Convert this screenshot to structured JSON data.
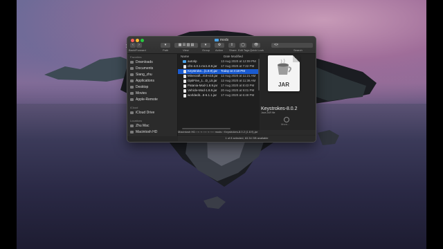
{
  "window": {
    "title": "mods"
  },
  "toolbar": {
    "back_forward_label": "Back/Forward",
    "path_label": "Path",
    "view_label": "View",
    "group_label": "Group",
    "action_label": "Action",
    "share_label": "Share",
    "edit_tags_label": "Edit Tags",
    "quick_look_label": "Quick Look",
    "search_label": "Search"
  },
  "sidebar": {
    "favorites_header": "Favorites",
    "icloud_header": "iCloud",
    "locations_header": "Locations",
    "favorites": [
      {
        "label": "Downloads",
        "icon": "downloads-icon"
      },
      {
        "label": "Documents",
        "icon": "documents-icon"
      },
      {
        "label": "Siang_zhu",
        "icon": "home-icon"
      },
      {
        "label": "Applications",
        "icon": "applications-icon"
      },
      {
        "label": "Desktop",
        "icon": "desktop-icon"
      },
      {
        "label": "Movies",
        "icon": "movies-icon"
      },
      {
        "label": "Apple-Remote",
        "icon": "folder-icon"
      }
    ],
    "icloud": [
      {
        "label": "iCloud Drive",
        "icon": "cloud-icon"
      }
    ],
    "locations": [
      {
        "label": "Zhu Mac",
        "icon": "computer-icon"
      },
      {
        "label": "Macintosh HD",
        "icon": "disk-icon"
      }
    ]
  },
  "list": {
    "col_name": "Name",
    "col_date": "Date Modified",
    "rows": [
      {
        "name": "autotip",
        "date": "13 Aug 2020 at 12:09 PM",
        "kind": "folder"
      },
      {
        "name": "cfm-4.0.1-mc1.8.9.jar",
        "date": "17 Aug 2020 at 7:22 PM",
        "kind": "jar"
      },
      {
        "name": "Keystroke...(1.8.9).jar",
        "date": "Today at 3:18 PM",
        "kind": "jar",
        "selected": true
      },
      {
        "name": "Minecraft...8.8-v10.jar",
        "date": "12 Aug 2020 at 11:21 AM",
        "kind": "jar"
      },
      {
        "name": "OptiFine_1...D_L5.jar",
        "date": "12 Aug 2020 at 11:36 AM",
        "kind": "jar"
      },
      {
        "name": "Patania-Mod-1.8.9.jar",
        "date": "17 Aug 2020 at 8:43 PM",
        "kind": "jar"
      },
      {
        "name": "Vehicle-Mod-1.8.9.jar",
        "date": "20 Aug 2020 at 9:01 PM",
        "kind": "jar"
      },
      {
        "name": "worldedit...8-6.1.1.jar",
        "date": "17 Aug 2020 at 6:49 PM",
        "kind": "jar"
      }
    ]
  },
  "preview": {
    "icon_label": "JAR",
    "title": "Keystrokes-8.0.2",
    "subtitle": "Java JAR file",
    "more": "More..."
  },
  "pathbar": {
    "root": "Macintosh HD",
    "folder": "mods",
    "file": "Keystrokes-8.0.2 (1.8.9).jar"
  },
  "status": {
    "text": "1 of 8 selected, 63.34 GB available"
  },
  "colors": {
    "selection": "#1a5bd0",
    "window_bg": "#262626",
    "folder": "#4aa3e8"
  }
}
